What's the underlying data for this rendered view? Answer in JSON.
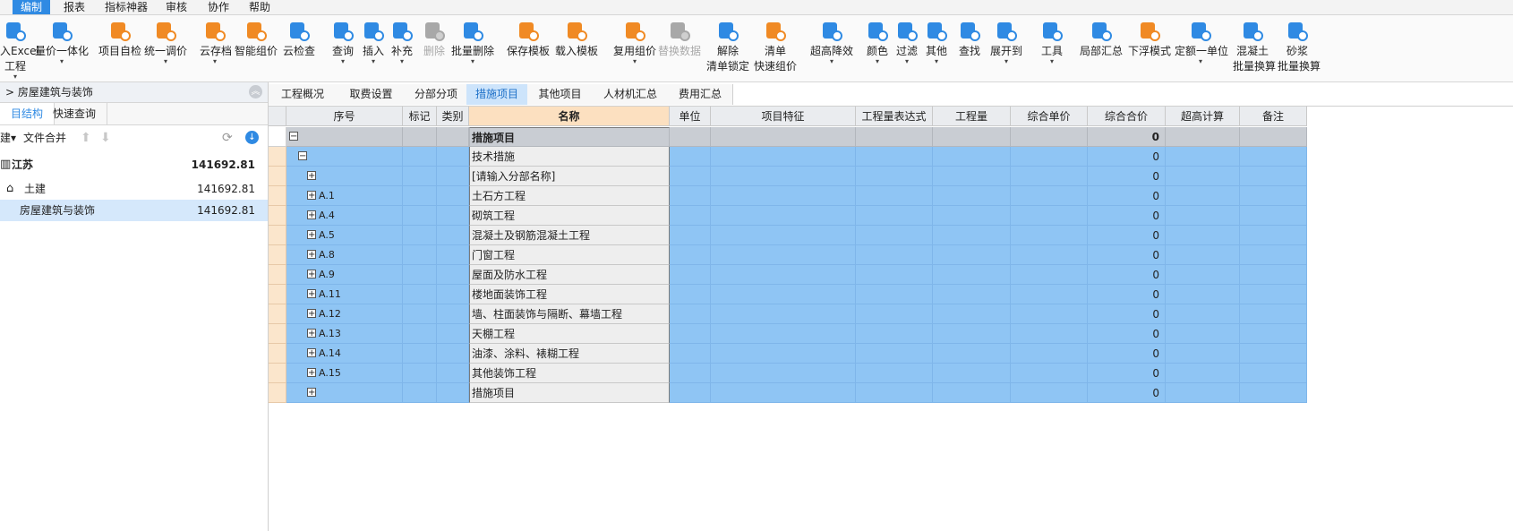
{
  "menu": [
    "编制",
    "报表",
    "指标神器",
    "审核",
    "协作",
    "帮助"
  ],
  "ribbon": [
    {
      "label1": "入Excel",
      "label2": "工程",
      "arrow": true,
      "icon": "import-excel-icon",
      "color": "#2f8ae3"
    },
    {
      "label1": "量价一体化",
      "label2": "",
      "arrow": true,
      "icon": "quantity-price-icon",
      "color": "#2f8ae3"
    },
    {
      "label1": "项目自检",
      "label2": "",
      "arrow": false,
      "icon": "project-check-icon",
      "color": "#f08a24"
    },
    {
      "label1": "统一调价",
      "label2": "",
      "arrow": true,
      "icon": "adjust-price-icon",
      "color": "#f08a24"
    },
    {
      "label1": "云存档",
      "label2": "",
      "arrow": true,
      "icon": "cloud-upload-icon",
      "color": "#f08a24"
    },
    {
      "label1": "智能组价",
      "label2": "",
      "arrow": false,
      "icon": "smart-price-icon",
      "color": "#f08a24"
    },
    {
      "label1": "云检查",
      "label2": "",
      "arrow": false,
      "icon": "cloud-check-icon",
      "color": "#2f8ae3"
    },
    {
      "label1": "查询",
      "label2": "",
      "arrow": true,
      "icon": "query-icon",
      "color": "#2f8ae3"
    },
    {
      "label1": "插入",
      "label2": "",
      "arrow": true,
      "icon": "insert-icon",
      "color": "#2f8ae3"
    },
    {
      "label1": "补充",
      "label2": "",
      "arrow": true,
      "icon": "supplement-icon",
      "color": "#2f8ae3"
    },
    {
      "label1": "删除",
      "label2": "",
      "arrow": false,
      "icon": "delete-icon",
      "color": "#a8a8a8",
      "disabled": true
    },
    {
      "label1": "批量删除",
      "label2": "",
      "arrow": true,
      "icon": "batch-delete-icon",
      "color": "#2f8ae3"
    },
    {
      "label1": "保存模板",
      "label2": "",
      "arrow": false,
      "icon": "save-template-icon",
      "color": "#f08a24"
    },
    {
      "label1": "载入模板",
      "label2": "",
      "arrow": false,
      "icon": "load-template-icon",
      "color": "#f08a24"
    },
    {
      "label1": "复用组价",
      "label2": "",
      "arrow": true,
      "icon": "reuse-price-icon",
      "color": "#f08a24"
    },
    {
      "label1": "替换数据",
      "label2": "",
      "arrow": false,
      "icon": "replace-data-icon",
      "color": "#a8a8a8",
      "disabled": true
    },
    {
      "label1": "解除",
      "label2": "清单锁定",
      "arrow": false,
      "icon": "unlock-list-icon",
      "color": "#2f8ae3"
    },
    {
      "label1": "清单",
      "label2": "快速组价",
      "arrow": false,
      "icon": "quick-price-icon",
      "color": "#f08a24"
    },
    {
      "label1": "超高降效",
      "label2": "",
      "arrow": true,
      "icon": "height-efficiency-icon",
      "color": "#2f8ae3"
    },
    {
      "label1": "颜色",
      "label2": "",
      "arrow": true,
      "icon": "color-bucket-icon",
      "color": "#2f8ae3"
    },
    {
      "label1": "过滤",
      "label2": "",
      "arrow": true,
      "icon": "filter-icon",
      "color": "#2f8ae3"
    },
    {
      "label1": "其他",
      "label2": "",
      "arrow": true,
      "icon": "other-grid-icon",
      "color": "#2f8ae3"
    },
    {
      "label1": "查找",
      "label2": "",
      "arrow": false,
      "icon": "binoculars-icon",
      "color": "#2f8ae3"
    },
    {
      "label1": "展开到",
      "label2": "",
      "arrow": true,
      "icon": "expand-to-icon",
      "color": "#2f8ae3"
    },
    {
      "label1": "工具",
      "label2": "",
      "arrow": true,
      "icon": "tool-icon",
      "color": "#2f8ae3"
    },
    {
      "label1": "局部汇总",
      "label2": "",
      "arrow": false,
      "icon": "partial-summary-icon",
      "color": "#2f8ae3"
    },
    {
      "label1": "下浮模式",
      "label2": "",
      "arrow": false,
      "icon": "float-down-icon",
      "color": "#f08a24"
    },
    {
      "label1": "定额一单位",
      "label2": "",
      "arrow": true,
      "icon": "quota-unit-icon",
      "color": "#2f8ae3"
    },
    {
      "label1": "混凝土",
      "label2": "批量换算",
      "arrow": false,
      "icon": "concrete-convert-icon",
      "color": "#2f8ae3"
    },
    {
      "label1": "砂浆",
      "label2": "批量换算",
      "arrow": false,
      "icon": "mortar-convert-icon",
      "color": "#2f8ae3"
    }
  ],
  "left_panel": {
    "title": "> 房屋建筑与装饰",
    "tabs": [
      "目结构",
      "快速查询"
    ],
    "tool_first": "建▾",
    "tool_merge": "文件合并",
    "tree": [
      {
        "label": "江苏",
        "amount": "141692.81",
        "bold": true
      },
      {
        "label": "土建",
        "amount": "141692.81",
        "bold": false
      },
      {
        "label": "房屋建筑与装饰",
        "amount": "141692.81",
        "bold": false
      }
    ]
  },
  "main_tabs": [
    "工程概况",
    "取费设置",
    "分部分项",
    "措施项目",
    "其他项目",
    "人材机汇总",
    "费用汇总"
  ],
  "active_tab": "措施项目",
  "columns": [
    "序号",
    "标记",
    "类别",
    "名称",
    "单位",
    "项目特征",
    "工程量表达式",
    "工程量",
    "综合单价",
    "综合合价",
    "超高计算",
    "备注"
  ],
  "rows": [
    {
      "code": "",
      "name": "措施项目",
      "total": "0",
      "toggle": "−"
    },
    {
      "code": "",
      "name": "技术措施",
      "total": "0",
      "toggle": "−"
    },
    {
      "code": "",
      "name": "[请输入分部名称]",
      "total": "0",
      "toggle": "+"
    },
    {
      "code": "A.1",
      "name": "土石方工程",
      "total": "0",
      "toggle": "+"
    },
    {
      "code": "A.4",
      "name": "砌筑工程",
      "total": "0",
      "toggle": "+"
    },
    {
      "code": "A.5",
      "name": "混凝土及钢筋混凝土工程",
      "total": "0",
      "toggle": "+"
    },
    {
      "code": "A.8",
      "name": "门窗工程",
      "total": "0",
      "toggle": "+"
    },
    {
      "code": "A.9",
      "name": "屋面及防水工程",
      "total": "0",
      "toggle": "+"
    },
    {
      "code": "A.11",
      "name": "楼地面装饰工程",
      "total": "0",
      "toggle": "+"
    },
    {
      "code": "A.12",
      "name": "墙、柱面装饰与隔断、幕墙工程",
      "total": "0",
      "toggle": "+"
    },
    {
      "code": "A.13",
      "name": "天棚工程",
      "total": "0",
      "toggle": "+"
    },
    {
      "code": "A.14",
      "name": "油漆、涂料、裱糊工程",
      "total": "0",
      "toggle": "+"
    },
    {
      "code": "A.15",
      "name": "其他装饰工程",
      "total": "0",
      "toggle": "+"
    },
    {
      "code": "",
      "name": "措施项目",
      "total": "0",
      "toggle": "+"
    }
  ]
}
